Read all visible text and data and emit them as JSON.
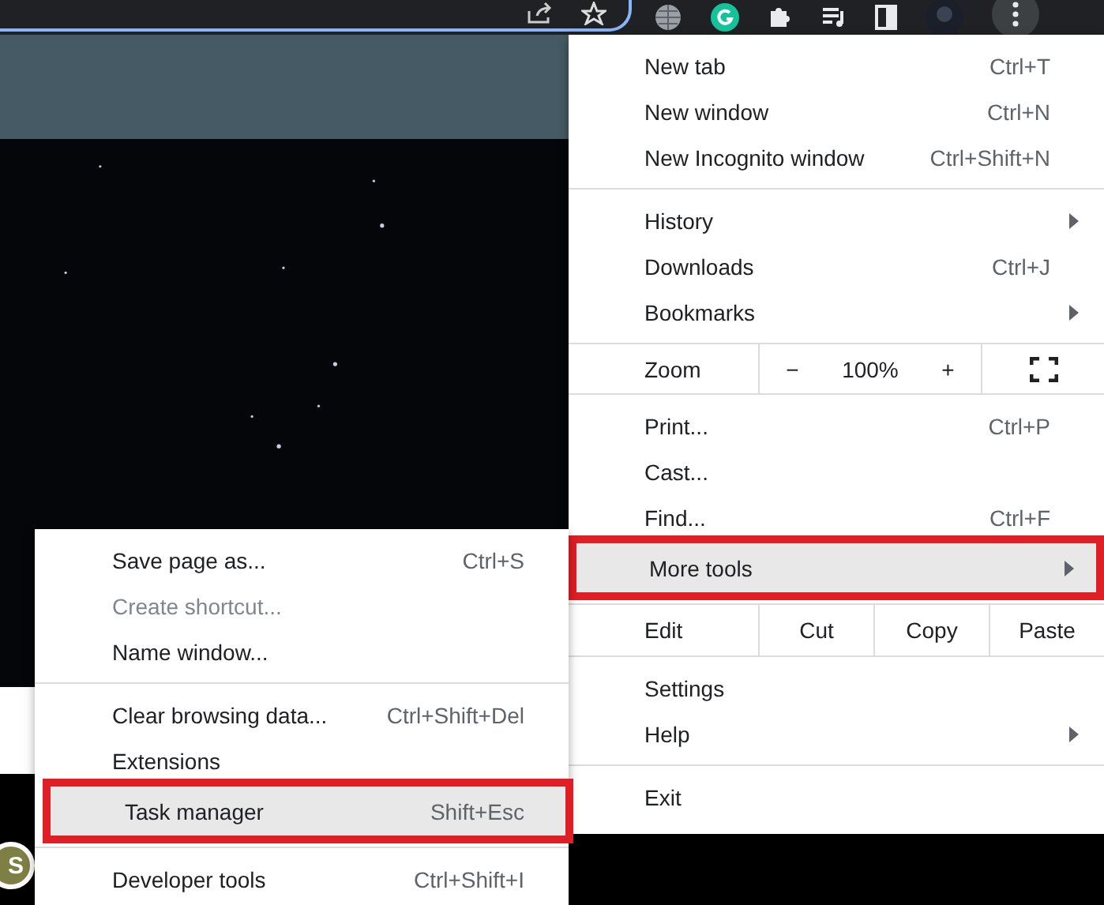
{
  "page": {
    "avatar": {
      "letter": "S"
    }
  },
  "menu": {
    "sections": [
      {
        "kind": "items",
        "items": [
          {
            "label": "New tab",
            "shortcut": "Ctrl+T",
            "has_submenu": false,
            "disabled": false,
            "selected": false
          },
          {
            "label": "New window",
            "shortcut": "Ctrl+N",
            "has_submenu": false,
            "disabled": false,
            "selected": false
          },
          {
            "label": "New Incognito window",
            "shortcut": "Ctrl+Shift+N",
            "has_submenu": false,
            "disabled": false,
            "selected": false
          }
        ]
      },
      {
        "kind": "items",
        "items": [
          {
            "label": "History",
            "has_submenu": true,
            "disabled": false,
            "selected": false
          },
          {
            "label": "Downloads",
            "shortcut": "Ctrl+J",
            "has_submenu": false,
            "disabled": false,
            "selected": false
          },
          {
            "label": "Bookmarks",
            "has_submenu": true,
            "disabled": false,
            "selected": false
          }
        ]
      },
      {
        "kind": "zoom",
        "label": "Zoom",
        "minus": "−",
        "level": "100%",
        "plus": "+"
      },
      {
        "kind": "items",
        "items": [
          {
            "label": "Print...",
            "shortcut": "Ctrl+P",
            "has_submenu": false,
            "disabled": false,
            "selected": false
          },
          {
            "label": "Cast...",
            "has_submenu": false,
            "disabled": false,
            "selected": false
          },
          {
            "label": "Find...",
            "shortcut": "Ctrl+F",
            "has_submenu": false,
            "disabled": false,
            "selected": false
          },
          {
            "label": "More tools",
            "has_submenu": true,
            "disabled": false,
            "selected": true
          }
        ]
      },
      {
        "kind": "edit",
        "label": "Edit",
        "actions": [
          "Cut",
          "Copy",
          "Paste"
        ]
      },
      {
        "kind": "items",
        "items": [
          {
            "label": "Settings",
            "has_submenu": false,
            "disabled": false,
            "selected": false
          },
          {
            "label": "Help",
            "has_submenu": true,
            "disabled": false,
            "selected": false
          }
        ]
      },
      {
        "kind": "items",
        "items": [
          {
            "label": "Exit",
            "has_submenu": false,
            "disabled": false,
            "selected": false
          }
        ]
      }
    ]
  },
  "submenu": {
    "sections": [
      {
        "kind": "items",
        "items": [
          {
            "label": "Save page as...",
            "shortcut": "Ctrl+S",
            "has_submenu": false,
            "disabled": false,
            "selected": false
          },
          {
            "label": "Create shortcut...",
            "has_submenu": false,
            "disabled": true,
            "selected": false
          },
          {
            "label": "Name window...",
            "has_submenu": false,
            "disabled": false,
            "selected": false
          }
        ]
      },
      {
        "kind": "items",
        "items": [
          {
            "label": "Clear browsing data...",
            "shortcut": "Ctrl+Shift+Del",
            "has_submenu": false,
            "disabled": false,
            "selected": false
          },
          {
            "label": "Extensions",
            "has_submenu": false,
            "disabled": false,
            "selected": false
          },
          {
            "label": "Task manager",
            "shortcut": "Shift+Esc",
            "has_submenu": false,
            "disabled": false,
            "selected": true
          }
        ]
      },
      {
        "kind": "items",
        "items": [
          {
            "label": "Developer tools",
            "shortcut": "Ctrl+Shift+I",
            "has_submenu": false,
            "disabled": false,
            "selected": false
          }
        ]
      }
    ]
  }
}
